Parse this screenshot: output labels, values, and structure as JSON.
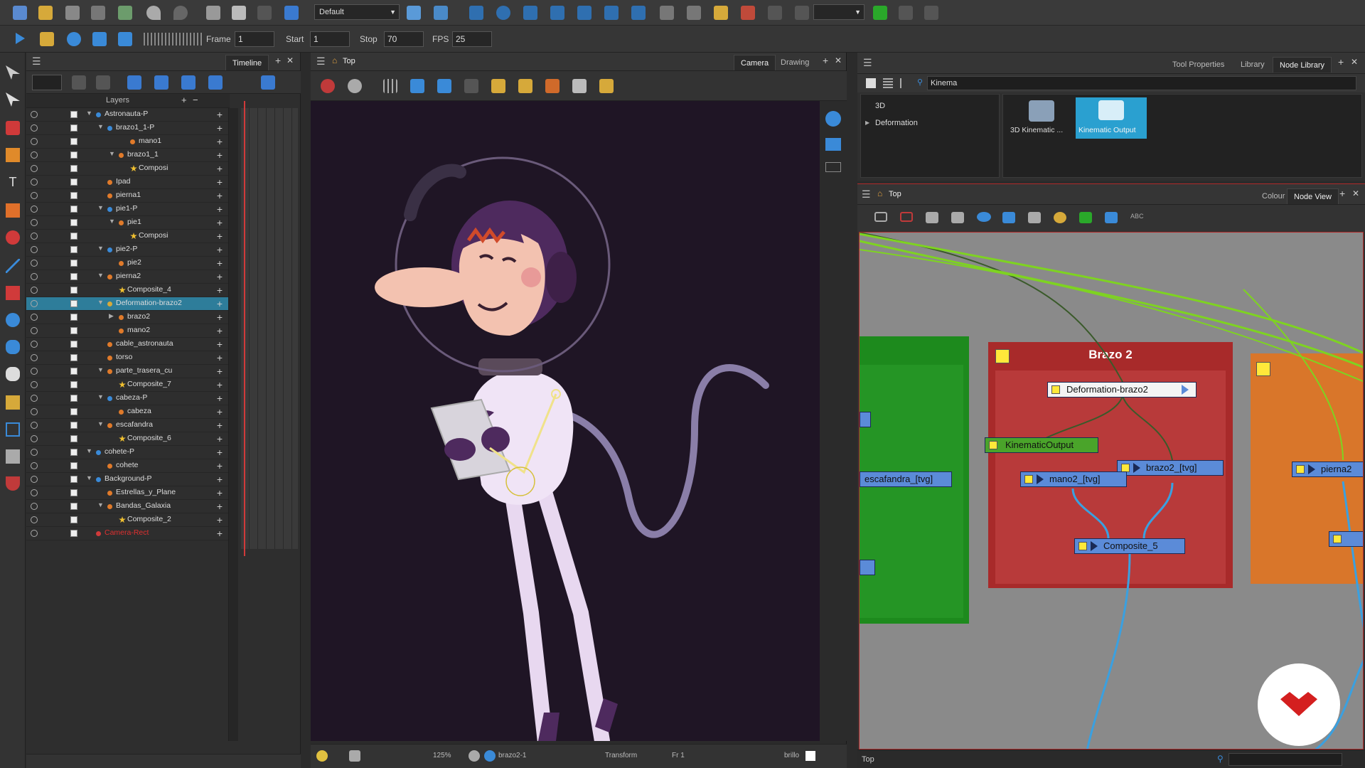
{
  "toolbar": {
    "view_preset": "Default",
    "frame_label": "Frame",
    "frame_value": "1",
    "start_label": "Start",
    "start_value": "1",
    "stop_label": "Stop",
    "stop_value": "70",
    "fps_label": "FPS",
    "fps_value": "25"
  },
  "timeline": {
    "tab": "Timeline",
    "layers_header": "Layers",
    "layers": [
      {
        "name": "Astronauta-P",
        "indent": 0,
        "kind": "peg",
        "expanded": true
      },
      {
        "name": "brazo1_1-P",
        "indent": 1,
        "kind": "peg",
        "expanded": true
      },
      {
        "name": "mano1",
        "indent": 3,
        "kind": "drawing"
      },
      {
        "name": "brazo1_1",
        "indent": 2,
        "kind": "drawing",
        "expanded": true
      },
      {
        "name": "Composi",
        "indent": 3,
        "kind": "composite"
      },
      {
        "name": "Ipad",
        "indent": 1,
        "kind": "drawing"
      },
      {
        "name": "pierna1",
        "indent": 1,
        "kind": "drawing"
      },
      {
        "name": "pie1-P",
        "indent": 1,
        "kind": "peg",
        "expanded": true
      },
      {
        "name": "pie1",
        "indent": 2,
        "kind": "drawing",
        "expanded": true
      },
      {
        "name": "Composi",
        "indent": 3,
        "kind": "composite"
      },
      {
        "name": "pie2-P",
        "indent": 1,
        "kind": "peg",
        "expanded": true
      },
      {
        "name": "pie2",
        "indent": 2,
        "kind": "drawing"
      },
      {
        "name": "pierna2",
        "indent": 1,
        "kind": "drawing",
        "expanded": true
      },
      {
        "name": "Composite_4",
        "indent": 2,
        "kind": "composite"
      },
      {
        "name": "Deformation-brazo2",
        "indent": 1,
        "kind": "deform",
        "expanded": true,
        "selected": true
      },
      {
        "name": "brazo2",
        "indent": 2,
        "kind": "drawing",
        "collapsed": true
      },
      {
        "name": "mano2",
        "indent": 2,
        "kind": "drawing"
      },
      {
        "name": "cable_astronauta",
        "indent": 1,
        "kind": "drawing"
      },
      {
        "name": "torso",
        "indent": 1,
        "kind": "drawing"
      },
      {
        "name": "parte_trasera_cu",
        "indent": 1,
        "kind": "drawing",
        "expanded": true
      },
      {
        "name": "Composite_7",
        "indent": 2,
        "kind": "composite"
      },
      {
        "name": "cabeza-P",
        "indent": 1,
        "kind": "peg",
        "expanded": true
      },
      {
        "name": "cabeza",
        "indent": 2,
        "kind": "drawing"
      },
      {
        "name": "escafandra",
        "indent": 1,
        "kind": "drawing",
        "expanded": true
      },
      {
        "name": "Composite_6",
        "indent": 2,
        "kind": "composite"
      },
      {
        "name": "cohete-P",
        "indent": 0,
        "kind": "peg",
        "expanded": true
      },
      {
        "name": "cohete",
        "indent": 1,
        "kind": "drawing"
      },
      {
        "name": "Background-P",
        "indent": 0,
        "kind": "peg",
        "expanded": true
      },
      {
        "name": "Estrellas_y_Plane",
        "indent": 1,
        "kind": "drawing"
      },
      {
        "name": "Bandas_Galaxia",
        "indent": 1,
        "kind": "drawing",
        "expanded": true
      },
      {
        "name": "Composite_2",
        "indent": 2,
        "kind": "composite"
      },
      {
        "name": "Camera-Rect",
        "indent": 0,
        "kind": "camera"
      }
    ]
  },
  "camera": {
    "title": "Top",
    "tab_camera": "Camera",
    "tab_drawing": "Drawing",
    "status_zoom": "125%",
    "status_drawing": "brazo2-1",
    "status_tool": "Transform",
    "status_frame": "Fr 1",
    "status_color": "brillo"
  },
  "nodelib": {
    "tab_tool_properties": "Tool Properties",
    "tab_library": "Library",
    "tab_node_library": "Node Library",
    "search_value": "Kinema",
    "categories": [
      "3D",
      "Deformation"
    ],
    "items": [
      "3D Kinematic ...",
      "Kinematic Output"
    ]
  },
  "nodeview": {
    "title": "Top",
    "tab_colour": "Colour",
    "tab_node_view": "Node View",
    "footer": "Top",
    "backdrop_title": "Brazo 2",
    "nodes": {
      "deformation": "Deformation-brazo2",
      "kinematic": "KinematicOutput",
      "brazo2": "brazo2_[tvg]",
      "mano2": "mano2_[tvg]",
      "composite5": "Composite_5",
      "escafandra": "escafandra_[tvg]",
      "pierna2": "pierna2"
    }
  },
  "colors": {
    "accent_select": "#2e7d9a",
    "backdrop_red": "#a82a2a",
    "backdrop_green": "#1d8a1d",
    "backdrop_orange": "#d9762a",
    "cable_green": "#7ed321",
    "cable_blue": "#3aa0e0",
    "node_blue": "#5b8bd8"
  }
}
